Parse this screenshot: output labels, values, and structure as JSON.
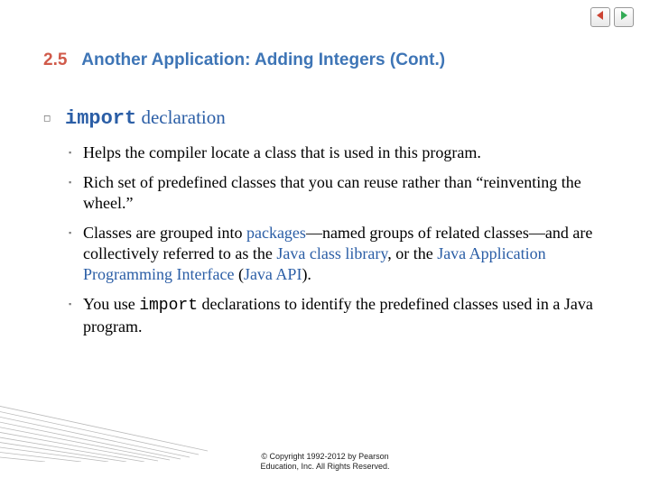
{
  "nav": {
    "prev_icon": "prev-arrow-icon",
    "next_icon": "next-arrow-icon"
  },
  "title": {
    "num": "2.5",
    "text": "Another Application: Adding Integers (Cont.)"
  },
  "heading": {
    "import_kw": "import",
    "declaration": " declaration"
  },
  "bullets": {
    "b1": "Helps the compiler locate a class that is used in this program.",
    "b2": "Rich set of predefined classes that you can reuse rather than “reinventing the wheel.”",
    "b3_parts": {
      "p1": "Classes are grouped into ",
      "packages": "packages",
      "p2": "—named groups of related classes—and are collectively referred to as the ",
      "jcl": "Java class library",
      "p3": ", or the ",
      "japi_long": "Java Application Programming Interface",
      "p4": " (",
      "japi_short": "Java API",
      "p5": ")."
    },
    "b4_parts": {
      "p1": "You use ",
      "import_kw": "import",
      "p2": " declarations to identify the predefined classes used in a Java program."
    }
  },
  "footer": {
    "line1": "© Copyright 1992-2012 by Pearson",
    "line2": "Education, Inc. All Rights Reserved."
  }
}
